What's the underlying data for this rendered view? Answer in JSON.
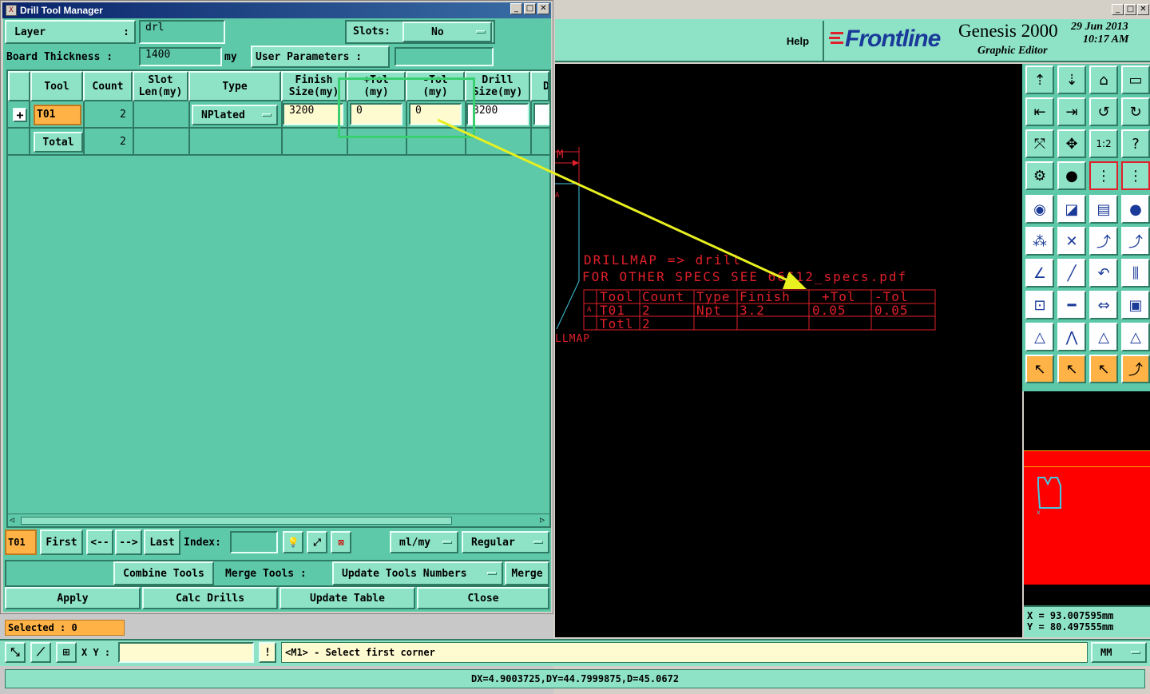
{
  "dialog": {
    "title": "Drill Tool Manager",
    "layer_label": "Layer",
    "layer_colon": ":",
    "layer_value": "drl",
    "slots_label": "Slots:",
    "slots_value": "No",
    "board_thickness_label": "Board Thickness :",
    "board_thickness_value": "1400",
    "board_thickness_unit": "my",
    "user_params_label": "User Parameters :",
    "user_params_value": "",
    "columns": [
      "Tool",
      "Count",
      "Slot\nLen(my)",
      "Type",
      "Finish\nSize(my)",
      "+Tol\n(my)",
      "-Tol\n(my)",
      "Drill\nSize(my)",
      "D"
    ],
    "rows": [
      {
        "tool": "T01",
        "count": "2",
        "type": "NPlated",
        "finish": "3200",
        "plus_tol": "0",
        "minus_tol": "0",
        "drill": "3200"
      },
      {
        "tool": "Total",
        "count": "2"
      }
    ],
    "current_tool": "T01",
    "nav": {
      "first": "First",
      "prev": "<--",
      "next": "-->",
      "last": "Last",
      "index_label": "Index:",
      "index_value": ""
    },
    "units_dropdown": "ml/my",
    "mode_dropdown": "Regular",
    "combine_tools": "Combine Tools",
    "merge_tools_label": "Merge Tools :",
    "update_tool_numbers": "Update Tools Numbers",
    "merge": "Merge",
    "apply": "Apply",
    "calc_drills": "Calc Drills",
    "update_table": "Update Table",
    "close": "Close"
  },
  "main_window": {
    "help": "Help",
    "brand": "Frontline",
    "product": "Genesis 2000",
    "subtitle": "Graphic Editor",
    "date": "29 Jun 2013",
    "time": "10:17 AM"
  },
  "canvas": {
    "label_m": "M",
    "label_a": "A",
    "drillmap_line1": "DRILLMAP => drill",
    "drillmap_line2": "FOR OTHER SPECS SEE 66612_specs.pdf",
    "table_headers": [
      "Tool",
      "Count",
      "Type",
      "Finish",
      "+Tol",
      "-Tol"
    ],
    "table_row1": [
      "T01",
      "2",
      "Npt",
      "3.2",
      "0.05",
      "0.05"
    ],
    "table_row2": [
      "Totl",
      "2"
    ],
    "row_marker": "A",
    "llmap_label": "LLMAP"
  },
  "coords": {
    "x": "X = 93.007595mm",
    "y": "Y = 80.497555mm"
  },
  "status": {
    "selected": "Selected : 0",
    "xy_label": "X Y :",
    "xy_value": "",
    "prompt": "<M1> - Select first corner",
    "units": "MM",
    "measurement": "DX=4.9003725,DY=44.7999875,D=45.0672"
  },
  "colors": {
    "teal": "#5ec9a9",
    "teal_light": "#8ee3c7",
    "canvas": "#000000",
    "red": "#e0202a",
    "arrow": "#e8f020",
    "highlight": "#3ad070",
    "orange": "#ffb347"
  }
}
